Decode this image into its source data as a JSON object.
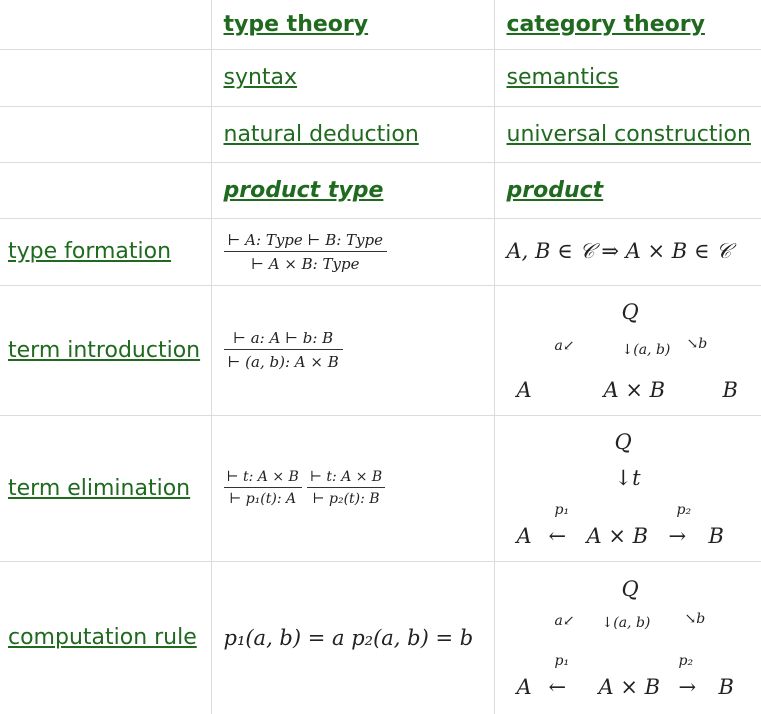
{
  "header": {
    "col2": "type theory",
    "col3": "category theory"
  },
  "rows_text": [
    {
      "col2": "syntax",
      "col3": "semantics"
    },
    {
      "col2": "natural deduction",
      "col3": "universal construction"
    },
    {
      "col2": "product type",
      "col3": "product"
    }
  ],
  "rows": {
    "formation": {
      "label": "type formation",
      "premise": "⊢ A: Type ⊢ B: Type",
      "conclusion": "⊢ A × B: Type",
      "semantics": "A, B ∈ 𝒞 ⇒ A × B ∈ 𝒞"
    },
    "introduction": {
      "label": "term introduction",
      "premise": "⊢ a: A ⊢ b: B",
      "conclusion": "⊢ (a, b): A × B",
      "diagram": {
        "Q": "Q",
        "a_arrow": "a↙",
        "pair_arrow": "↓(a, b)",
        "b_arrow": "↘b",
        "A": "A",
        "AxB": "A × B",
        "B": "B"
      }
    },
    "elimination": {
      "label": "term elimination",
      "premise1": "⊢ t: A × B",
      "premise2": "⊢ t: A × B",
      "conclusion1": "⊢ p₁(t): A",
      "conclusion2": "⊢ p₂(t): B",
      "diagram": {
        "Q": "Q",
        "t_arrow": "↓t",
        "p1": "p₁",
        "p2": "p₂",
        "A": "A",
        "left_arrow": "←",
        "AxB": "A × B",
        "right_arrow": "→",
        "B": "B"
      }
    },
    "computation": {
      "label": "computation rule",
      "equation": "p₁(a, b) = a p₂(a, b) = b",
      "diagram": {
        "Q": "Q",
        "a_arrow": "a↙",
        "pair_arrow": "↓(a, b)",
        "b_arrow": "↘b",
        "p1": "p₁",
        "p2": "p₂",
        "A": "A",
        "left_arrow": "←",
        "AxB": "A × B",
        "right_arrow": "→",
        "B": "B"
      }
    }
  },
  "colors": {
    "link": "#1f6a1f",
    "border": "#dcdcdc"
  }
}
